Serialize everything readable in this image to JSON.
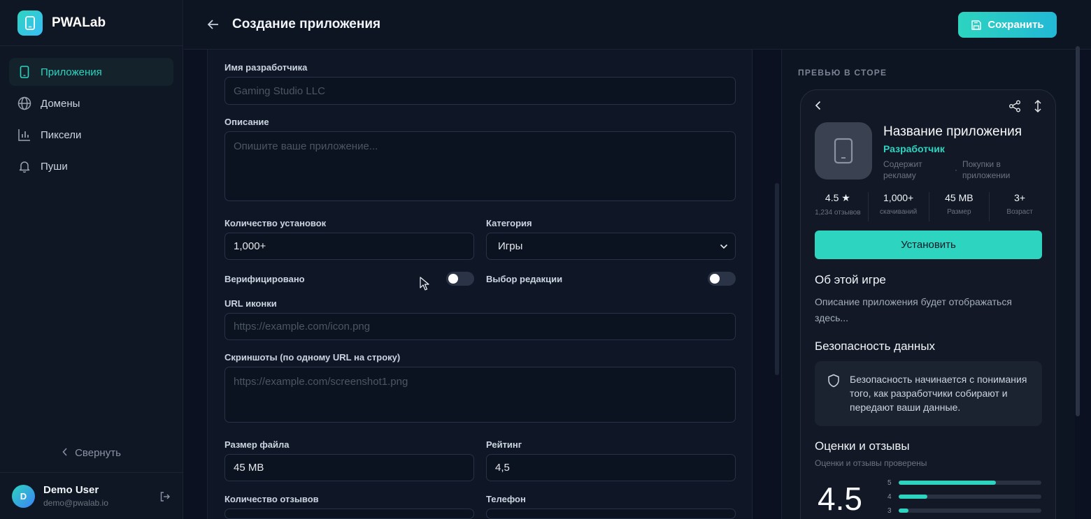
{
  "brand": {
    "name": "PWALab"
  },
  "sidebar": {
    "items": [
      {
        "label": "Приложения",
        "icon": "smartphone-icon",
        "active": true
      },
      {
        "label": "Домены",
        "icon": "globe-icon",
        "active": false
      },
      {
        "label": "Пиксели",
        "icon": "bar-chart-icon",
        "active": false
      },
      {
        "label": "Пуши",
        "icon": "bell-icon",
        "active": false
      }
    ],
    "collapse_label": "Свернуть"
  },
  "user": {
    "initial": "D",
    "name": "Demo User",
    "email": "demo@pwalab.io"
  },
  "header": {
    "title": "Создание приложения",
    "save_label": "Сохранить"
  },
  "form": {
    "developer": {
      "label": "Имя разработчика",
      "placeholder": "Gaming Studio LLC",
      "value": ""
    },
    "description": {
      "label": "Описание",
      "placeholder": "Опишите ваше приложение...",
      "value": ""
    },
    "installs": {
      "label": "Количество установок",
      "value": "1,000+"
    },
    "category": {
      "label": "Категория",
      "value": "Игры"
    },
    "verified": {
      "label": "Верифицировано",
      "on": false
    },
    "editors_choice": {
      "label": "Выбор редакции",
      "on": false
    },
    "icon_url": {
      "label": "URL иконки",
      "placeholder": "https://example.com/icon.png",
      "value": ""
    },
    "screenshots": {
      "label": "Скриншоты (по одному URL на строку)",
      "placeholder": "https://example.com/screenshot1.png",
      "value": ""
    },
    "file_size": {
      "label": "Размер файла",
      "value": "45 MB"
    },
    "rating": {
      "label": "Рейтинг",
      "value": "4,5"
    },
    "reviews_count": {
      "label": "Количество отзывов",
      "value": ""
    },
    "phone": {
      "label": "Телефон",
      "value": ""
    }
  },
  "preview": {
    "section_title": "ПРЕВЬЮ В СТОРЕ",
    "app_name": "Название приложения",
    "developer": "Разработчик",
    "meta_ads": "Содержит рекламу",
    "meta_dot": "·",
    "meta_purchases": "Покупки в приложении",
    "stats": [
      {
        "value": "4.5 ★",
        "label": "1,234 отзывов"
      },
      {
        "value": "1,000+",
        "label": "скачиваний"
      },
      {
        "value": "45 MB",
        "label": "Размер"
      },
      {
        "value": "3+",
        "label": "Возраст"
      }
    ],
    "install_label": "Установить",
    "about_title": "Об этой игре",
    "about_text": "Описание приложения будет отображаться здесь...",
    "safety_title": "Безопасность данных",
    "safety_text": "Безопасность начинается с понимания того, как разработчики собирают и передают ваши данные.",
    "ratings_title": "Оценки и отзывы",
    "ratings_subtitle": "Оценки и отзывы проверены",
    "big_rating": "4.5",
    "rating_bars": [
      {
        "stars": "5",
        "fraction": 0.68
      },
      {
        "stars": "4",
        "fraction": 0.2
      },
      {
        "stars": "3",
        "fraction": 0.07
      }
    ]
  },
  "colors": {
    "accent": "#2dd4bf",
    "background": "#0b1120",
    "panel": "#0f1726"
  }
}
